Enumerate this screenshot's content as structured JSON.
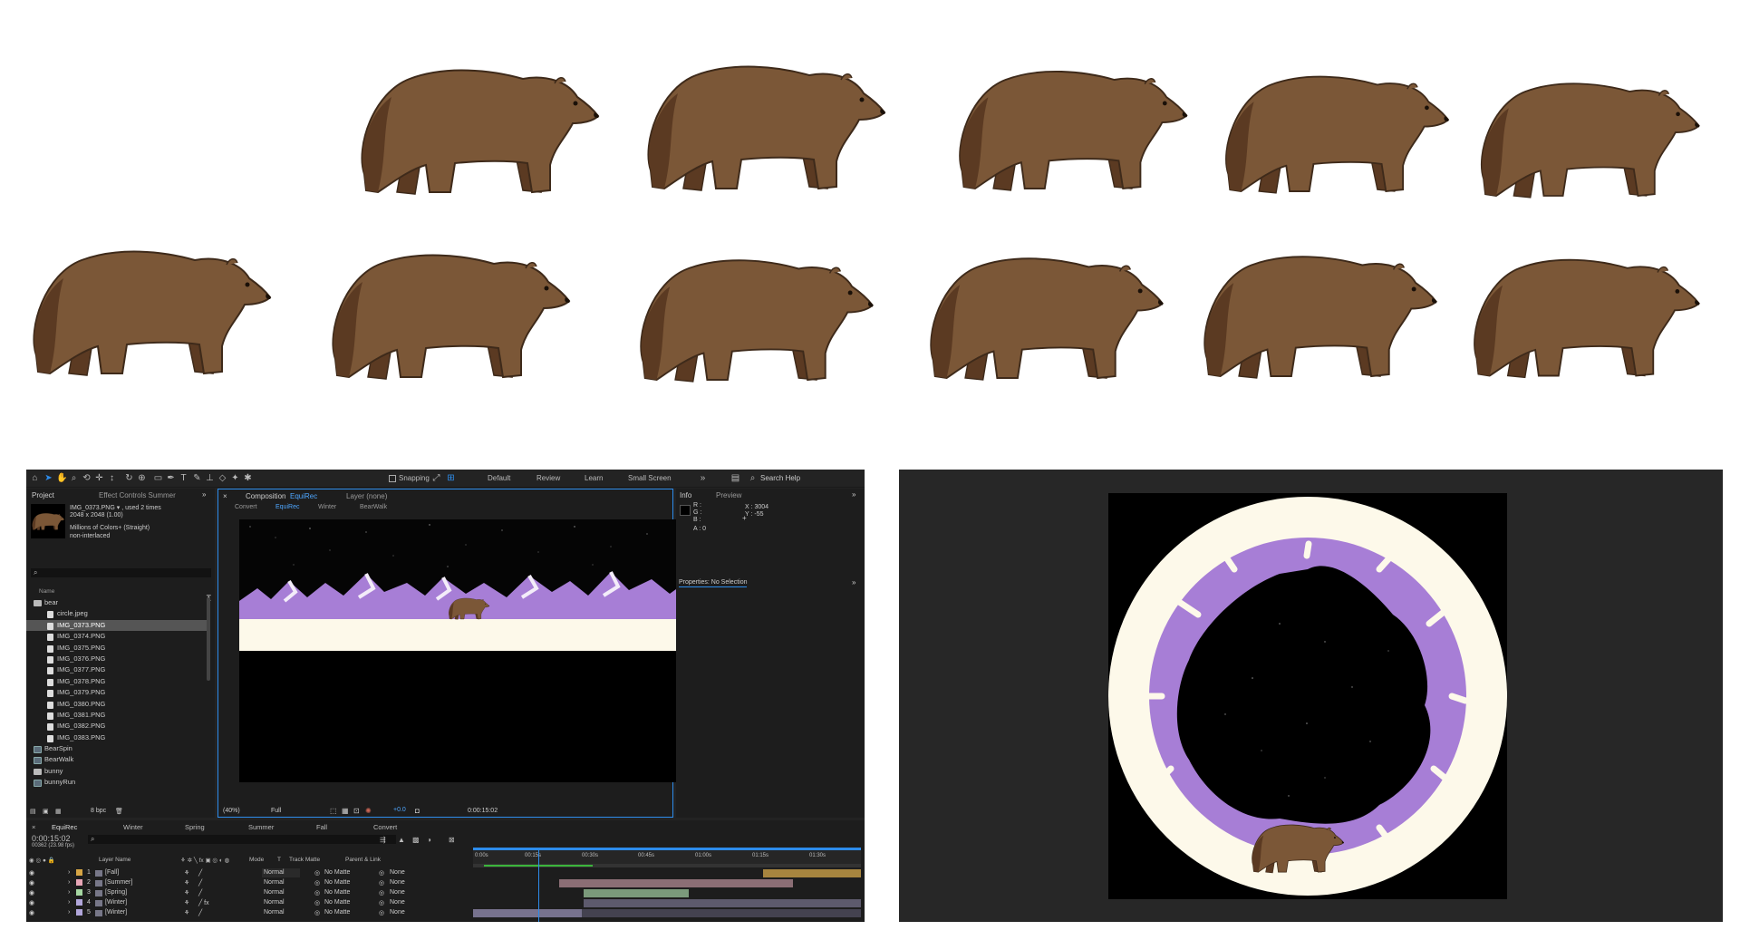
{
  "colors": {
    "bear_body": "#7b5737",
    "bear_dark": "#5b3a22",
    "bear_outline": "#3e2a1a",
    "ui_bg": "#232323",
    "accent_blue": "#2d8ceb",
    "mountain_purple": "#a77ed6",
    "snow": "#fdf9ea",
    "stars_bg": "#000000"
  },
  "toolbar": {
    "snapping": "Snapping",
    "workspaces": [
      "Default",
      "Review",
      "Learn",
      "Small Screen"
    ],
    "search_help": "Search Help"
  },
  "project_panel": {
    "tab_project": "Project",
    "tab_effect_controls": "Effect Controls Summer",
    "asset_name": "IMG_0373.PNG ▾ , used 2 times",
    "asset_size": "2048 x 2048 (1.00)",
    "asset_colors": "Millions of Colors+ (Straight)",
    "asset_interlace": "non-interlaced",
    "search_placeholder": "",
    "col_name": "Name",
    "folder_bear": "bear",
    "files": [
      "circle.jpeg",
      "IMG_0373.PNG",
      "IMG_0374.PNG",
      "IMG_0375.PNG",
      "IMG_0376.PNG",
      "IMG_0377.PNG",
      "IMG_0378.PNG",
      "IMG_0379.PNG",
      "IMG_0380.PNG",
      "IMG_0381.PNG",
      "IMG_0382.PNG",
      "IMG_0383.PNG"
    ],
    "selected_index": 1,
    "comps": [
      "BearSpin",
      "BearWalk"
    ],
    "folder_bunny": "bunny",
    "comp_bunnyrun": "bunnyRun",
    "bpc": "8 bpc"
  },
  "comp_panel": {
    "tab_label": "Composition",
    "comp_name": "EquiRec",
    "layer_tab": "Layer (none)",
    "breadcrumbs": [
      "Convert",
      "EquiRec",
      "Winter",
      "BearWalk"
    ],
    "zoom": "(40%)",
    "resolution": "Full",
    "exposure": "+0.0",
    "timecode": "0:00:15:02"
  },
  "info_panel": {
    "tab_info": "Info",
    "tab_preview": "Preview",
    "r": "R :",
    "g": "G :",
    "b": "B :",
    "a": "A : 0",
    "x": "X : 3004",
    "y": "Y : -55",
    "properties": "Properties: No Selection"
  },
  "timeline": {
    "tabs": [
      "EquiRec",
      "Winter",
      "Spring",
      "Summer",
      "Fall",
      "Convert"
    ],
    "timecode": "0:00:15:02",
    "fps": "00362 (23.98 fps)",
    "col_layer": "Layer Name",
    "col_mode": "Mode",
    "col_t": "T",
    "col_trackmatte": "Track Matte",
    "col_parent": "Parent & Link",
    "ruler": [
      "0:00s",
      "00:15s",
      "00:30s",
      "00:45s",
      "01:00s",
      "01:15s",
      "01:30s"
    ],
    "layers": [
      {
        "num": "1",
        "name": "[Fall]",
        "mode": "Normal",
        "matte": "No Matte",
        "parent": "None",
        "color": "#d6a545"
      },
      {
        "num": "2",
        "name": "[Summer]",
        "mode": "Normal",
        "matte": "No Matte",
        "parent": "None",
        "color": "#e7a6b6"
      },
      {
        "num": "3",
        "name": "[Spring]",
        "mode": "Normal",
        "matte": "No Matte",
        "parent": "None",
        "color": "#a6d7a2"
      },
      {
        "num": "4",
        "name": "[Winter]",
        "mode": "Normal",
        "matte": "No Matte",
        "parent": "None",
        "color": "#b1a6da"
      },
      {
        "num": "5",
        "name": "[Winter]",
        "mode": "Normal",
        "matte": "No Matte",
        "parent": "None",
        "color": "#b1a6da"
      }
    ]
  }
}
